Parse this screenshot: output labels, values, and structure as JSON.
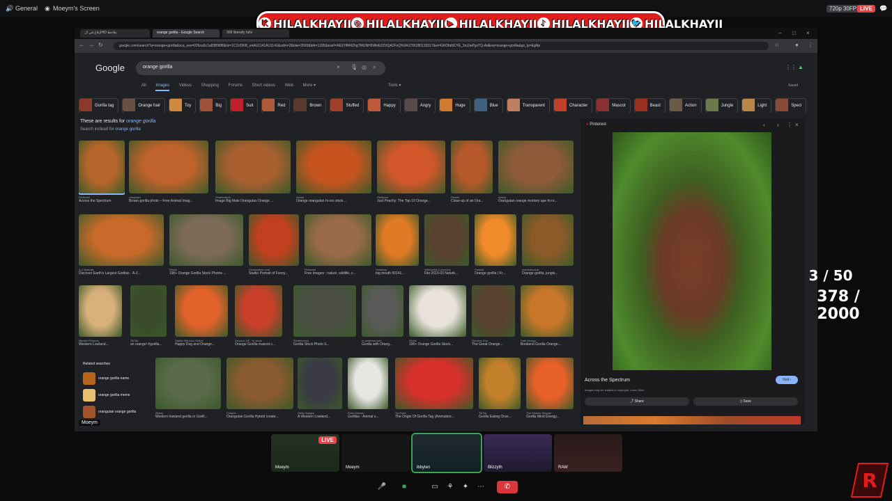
{
  "discord": {
    "channel": "General",
    "screen_title": "Moeym's Screen",
    "resolution": "720p 30FPS",
    "live": "LIVE"
  },
  "banner": {
    "handles": [
      "HILALKHAYII",
      "HILALKHAYII",
      "HILALKHAYII",
      "HILALKHAYII",
      "HILALKHAYII"
    ]
  },
  "browser": {
    "tabs": [
      "لإبلاغ في الHD ملاحظ",
      "orange gorilla - Google Search",
      "308 liberally fulls"
    ],
    "url": "google.com/search?q=orange+gorilla&sca_esv=026ca5c1a83896f8&rlz=1C1VDKB_enAU1141AU1141&udm=2&biw=2560&bih=1335&sxsrf=AE3TifM4ZhgTMUNH9WktE2ZXQA2FsQ%3A1755280133317&ei=GKOfaNCYE_3ru2wPgvTQ-Ad&oq=orange+gorilla&gs_lp=EgNp"
  },
  "google": {
    "logo": "Google",
    "query": "orange gorilla",
    "tabs": [
      "All",
      "Images",
      "Videos",
      "Shopping",
      "Forums",
      "Short videos",
      "Web",
      "More ▾",
      "Tools ▾"
    ],
    "selected_tab": "Images",
    "saved": "Saved",
    "chips": [
      "Gorilla tag",
      "Orange hair",
      "Toy",
      "Big",
      "Suit",
      "Red",
      "Brown",
      "Stuffed",
      "Happy",
      "Angry",
      "Huge",
      "Blue",
      "Transparent",
      "Character",
      "Mascot",
      "Beast",
      "Action",
      "Jungle",
      "Light",
      "Speci"
    ],
    "notice_prefix": "These are results for ",
    "notice_query": "orange gorilla",
    "notice2_prefix": "Search instead for ",
    "notice2_query": "orange gorilla"
  },
  "results": [
    {
      "src": "Pinterest",
      "cap": "Across the Spectrum",
      "color": "#b5652a"
    },
    {
      "src": "Unsplash",
      "cap": "Brown gorilla photo – Free Animal Imag...",
      "color": "#c0622b"
    },
    {
      "src": "Shutterstock",
      "cap": "Image Big Male Orangutan Orange ...",
      "color": "#a95f30"
    },
    {
      "src": "Alamy",
      "cap": "Orange orangutan hi-res stock ...",
      "color": "#c7541f"
    },
    {
      "src": "Pinterest",
      "cap": "Just Peachy: The Top 10 Orange...",
      "color": "#d1572b"
    },
    {
      "src": "Pexels",
      "cap": "Close-up of an Ora...",
      "color": "#b7582a"
    },
    {
      "src": "Alamy",
      "cap": "Orangutan orange monkey ape hi-re...",
      "color": "#8e5a3a"
    },
    {
      "src": "A-Z Animals",
      "cap": "Discover Earth's Largest Gorillas - A-Z...",
      "color": "#c96a2a"
    },
    {
      "src": "iStock",
      "cap": "190+ Orange Gorilla Stock Photos ...",
      "color": "#7d6a58"
    },
    {
      "src": "Dreamstime.com",
      "cap": "Studio Portrait of Funny...",
      "color": "#c2401f"
    },
    {
      "src": "Pinterest",
      "cap": "Free Images : nature, wildlife, z...",
      "color": "#9b6a4a"
    },
    {
      "src": "Vecteezy",
      "cap": "big mouth 50141...",
      "color": "#e07a24"
    },
    {
      "src": "Wikimedia Commons",
      "cap": "File:2013-03 Naturk...",
      "color": "#5a4030"
    },
    {
      "src": "Freepik",
      "cap": "Orange gorilla | Fr...",
      "color": "#f08a2a"
    },
    {
      "src": "cheetorium.ai",
      "cap": "Orange gorilla, jungle...",
      "color": "#8a5a28"
    },
    {
      "src": "Minden Pictures",
      "cap": "Western Lowland...",
      "color": "#d8b07a"
    },
    {
      "src": "TikTok",
      "cap": "an orange! #gorilla...",
      "color": "#3a4a2a"
    },
    {
      "src": "Stable Diffusion Online",
      "cap": "Happy Dog and Orange...",
      "color": "#e2622a"
    },
    {
      "src": "Amazon UK · In stock",
      "cap": "Orange Gorilla mascot c...",
      "color": "#c8402a"
    },
    {
      "src": "Shutterstock",
      "cap": "Gorilla Stock Photo S...",
      "color": "#4a4d44"
    },
    {
      "src": "m.pinterest.com",
      "cap": "Gorilla with Orang...",
      "color": "#5a5a58"
    },
    {
      "src": "iStock",
      "cap": "190+ Orange Gorilla Stock...",
      "color": "#e8e2da"
    },
    {
      "src": "Houston Zoo",
      "cap": "The Great Orange...",
      "color": "#5a4030"
    },
    {
      "src": "Kate Design",
      "cap": "Bookend Gorilla Orange...",
      "color": "#c8772a"
    },
    {
      "src": "Alamy",
      "cap": "Western lowland gorilla or Gorill...",
      "color": "#5a6a4a"
    },
    {
      "src": "Craiyon",
      "cap": "Orangutan Gorilla Hybrid create...",
      "color": "#8a5a30"
    },
    {
      "src": "Getty Images",
      "cap": "A Western Lowland...",
      "color": "#3a3a44"
    },
    {
      "src": "Eddy Maroso",
      "cap": "Gorillas - Animal s...",
      "color": "#e8e6e2"
    },
    {
      "src": "YouTube",
      "cap": "The Origin Of Gorilla Tag (Animation...",
      "color": "#d8302a"
    },
    {
      "src": "TikTok",
      "cap": "Gorilla Eating Oran...",
      "color": "#c2802a"
    },
    {
      "src": "The Vitamin Shoppe",
      "cap": "Gorilla Mind Energy...",
      "color": "#e8602a"
    }
  ],
  "related": {
    "title": "Related searches",
    "items": [
      "orange gorilla name",
      "orange gorilla meme",
      "orangutan orange gorilla"
    ]
  },
  "panel": {
    "source": "Pinterest",
    "title": "Across the Spectrum",
    "note": "Images may be subject to copyright. Learn More",
    "visit": "Visit ›",
    "share": "Share",
    "save": "Save"
  },
  "overlay": {
    "counter_a": "3 / 50",
    "counter_b": "378 / 2000"
  },
  "streamer": "Moeym",
  "participants": [
    {
      "name": "Moeym",
      "live": "LIVE"
    },
    {
      "name": "Moeym"
    },
    {
      "name": "ibbyten"
    },
    {
      "name": "Blizzyth"
    },
    {
      "name": "RAW"
    }
  ]
}
